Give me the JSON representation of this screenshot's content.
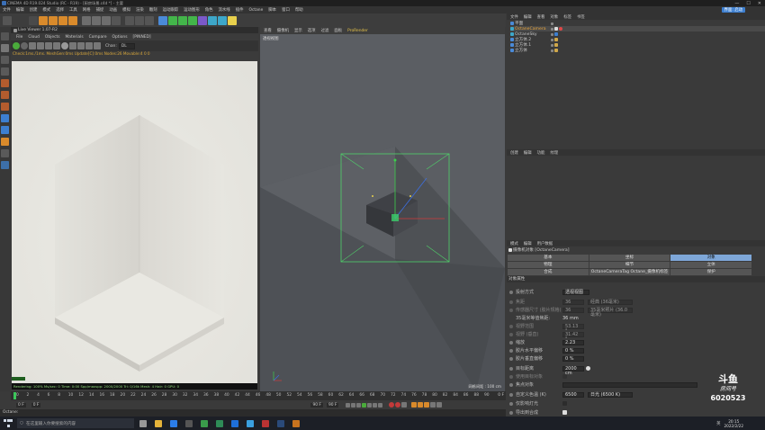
{
  "window": {
    "title": "CINEMA 4D R19.024 Studio (RC - R19) - [厨房场景.c4d *] - 主要",
    "controls": [
      "—",
      "☐",
      "✕"
    ]
  },
  "menubar": [
    "文件",
    "编辑",
    "创建",
    "模式",
    "选择",
    "工具",
    "网格",
    "捕捉",
    "动画",
    "模拟",
    "渲染",
    "雕刻",
    "运动跟踪",
    "运动图形",
    "角色",
    "流水线",
    "插件",
    "Octane",
    "脚本",
    "窗口",
    "帮助"
  ],
  "menubar_right": "界面: 启动",
  "live_viewer": {
    "title": "Live Viewer 1.07-R2",
    "menu": [
      "File",
      "Cloud",
      "Objects",
      "Materials",
      "Compare",
      "Options",
      "[PINNED]"
    ],
    "channel_label": "Chan:",
    "channel_value": "DL",
    "status": "Check:1ms./1ms. MeshGen:0ms Update[C]:0ms Nodes:26 Movable:4 0 0",
    "stats": "Rendering: 100%   Ms/sec: 0   Time: 0:00   Spp/maxspp: 2000/2000   Tri: 0/16k   Mesh: 4   Hair: 0   GPU: 0"
  },
  "viewport": {
    "menu": [
      "查看",
      "摄像机",
      "显示",
      "选项",
      "过滤",
      "面板",
      "ProRender"
    ],
    "label": "透视视图",
    "grid_info": "网格间距 : 100 cm"
  },
  "object_manager": {
    "menu": [
      "文件",
      "编辑",
      "查看",
      "对象",
      "标签",
      "书签"
    ],
    "objects": [
      {
        "name": "平面",
        "selected": false
      },
      {
        "name": "OctaneCamera",
        "selected": true
      },
      {
        "name": "OctaneSky",
        "selected": false
      },
      {
        "name": "立方体.2",
        "selected": false
      },
      {
        "name": "立方体.1",
        "selected": false
      },
      {
        "name": "立方体",
        "selected": false
      }
    ]
  },
  "layer_panel": {
    "menu": [
      "创建",
      "编辑",
      "功能",
      "纹理"
    ]
  },
  "attributes": {
    "menu": [
      "模式",
      "编辑",
      "用户数据"
    ],
    "title": "摄像机对象 [OctaneCamera]",
    "tabs_row1": [
      "基本",
      "坐标",
      "对象"
    ],
    "tabs_row2": [
      "物理",
      "细节",
      "立体"
    ],
    "tabs_row3": [
      "合成",
      "OctaneCameraTag Octane_摄像机标签",
      "保护"
    ],
    "section": "对象属性",
    "props": [
      {
        "label": "投射方式",
        "value": "透视视图"
      },
      {
        "label": "焦距",
        "value": "36"
      },
      {
        "label": "传感器尺寸 (胶片规格)",
        "value": "36"
      },
      {
        "label": "35毫米等值焦距:",
        "value": "36 mm"
      },
      {
        "label": "视野范围",
        "value": "53.13 °"
      },
      {
        "label": "视野 (垂直)",
        "value": "31.42 °"
      },
      {
        "label": "缩放",
        "value": "2.23"
      },
      {
        "label": "胶片水平偏移",
        "value": "0 %"
      },
      {
        "label": "胶片垂直偏移",
        "value": "0 %"
      },
      {
        "label": "目标距离",
        "value": "2000 cm"
      },
      {
        "label": "使用目标对象",
        "value": ""
      },
      {
        "label": "焦点对象",
        "value": ""
      },
      {
        "label": "自定义色温 (K)",
        "value": "6500"
      },
      {
        "label": "仅影响灯光",
        "value": ""
      },
      {
        "label": "导出到合成",
        "value": ""
      }
    ],
    "focal_preset": "经典 (36毫米)",
    "sensor_preset": "35毫米照片 (36.0毫米)",
    "temp_preset": "日光 (6500 K)"
  },
  "timeline": {
    "ticks": [
      "0",
      "2",
      "4",
      "6",
      "8",
      "10",
      "12",
      "14",
      "16",
      "18",
      "20",
      "22",
      "24",
      "26",
      "28",
      "30",
      "32",
      "34",
      "36",
      "38",
      "40",
      "42",
      "44",
      "46",
      "48",
      "50",
      "52",
      "54",
      "56",
      "58",
      "60",
      "62",
      "64",
      "66",
      "68",
      "70",
      "72",
      "74",
      "76",
      "78",
      "80",
      "82",
      "84",
      "86",
      "88",
      "90"
    ],
    "end_frame": "0 F",
    "start": "0 F",
    "current": "0 F",
    "max": "90 F",
    "max2": "90 F"
  },
  "statusbar": "Octane:",
  "taskbar": {
    "search_placeholder": "在这里输入你要搜索的内容",
    "time": "20:15",
    "date": "2022/2/22",
    "lang": "英"
  },
  "watermark": {
    "brand": "斗鱼",
    "sub": "房间号",
    "room": "6020523"
  }
}
